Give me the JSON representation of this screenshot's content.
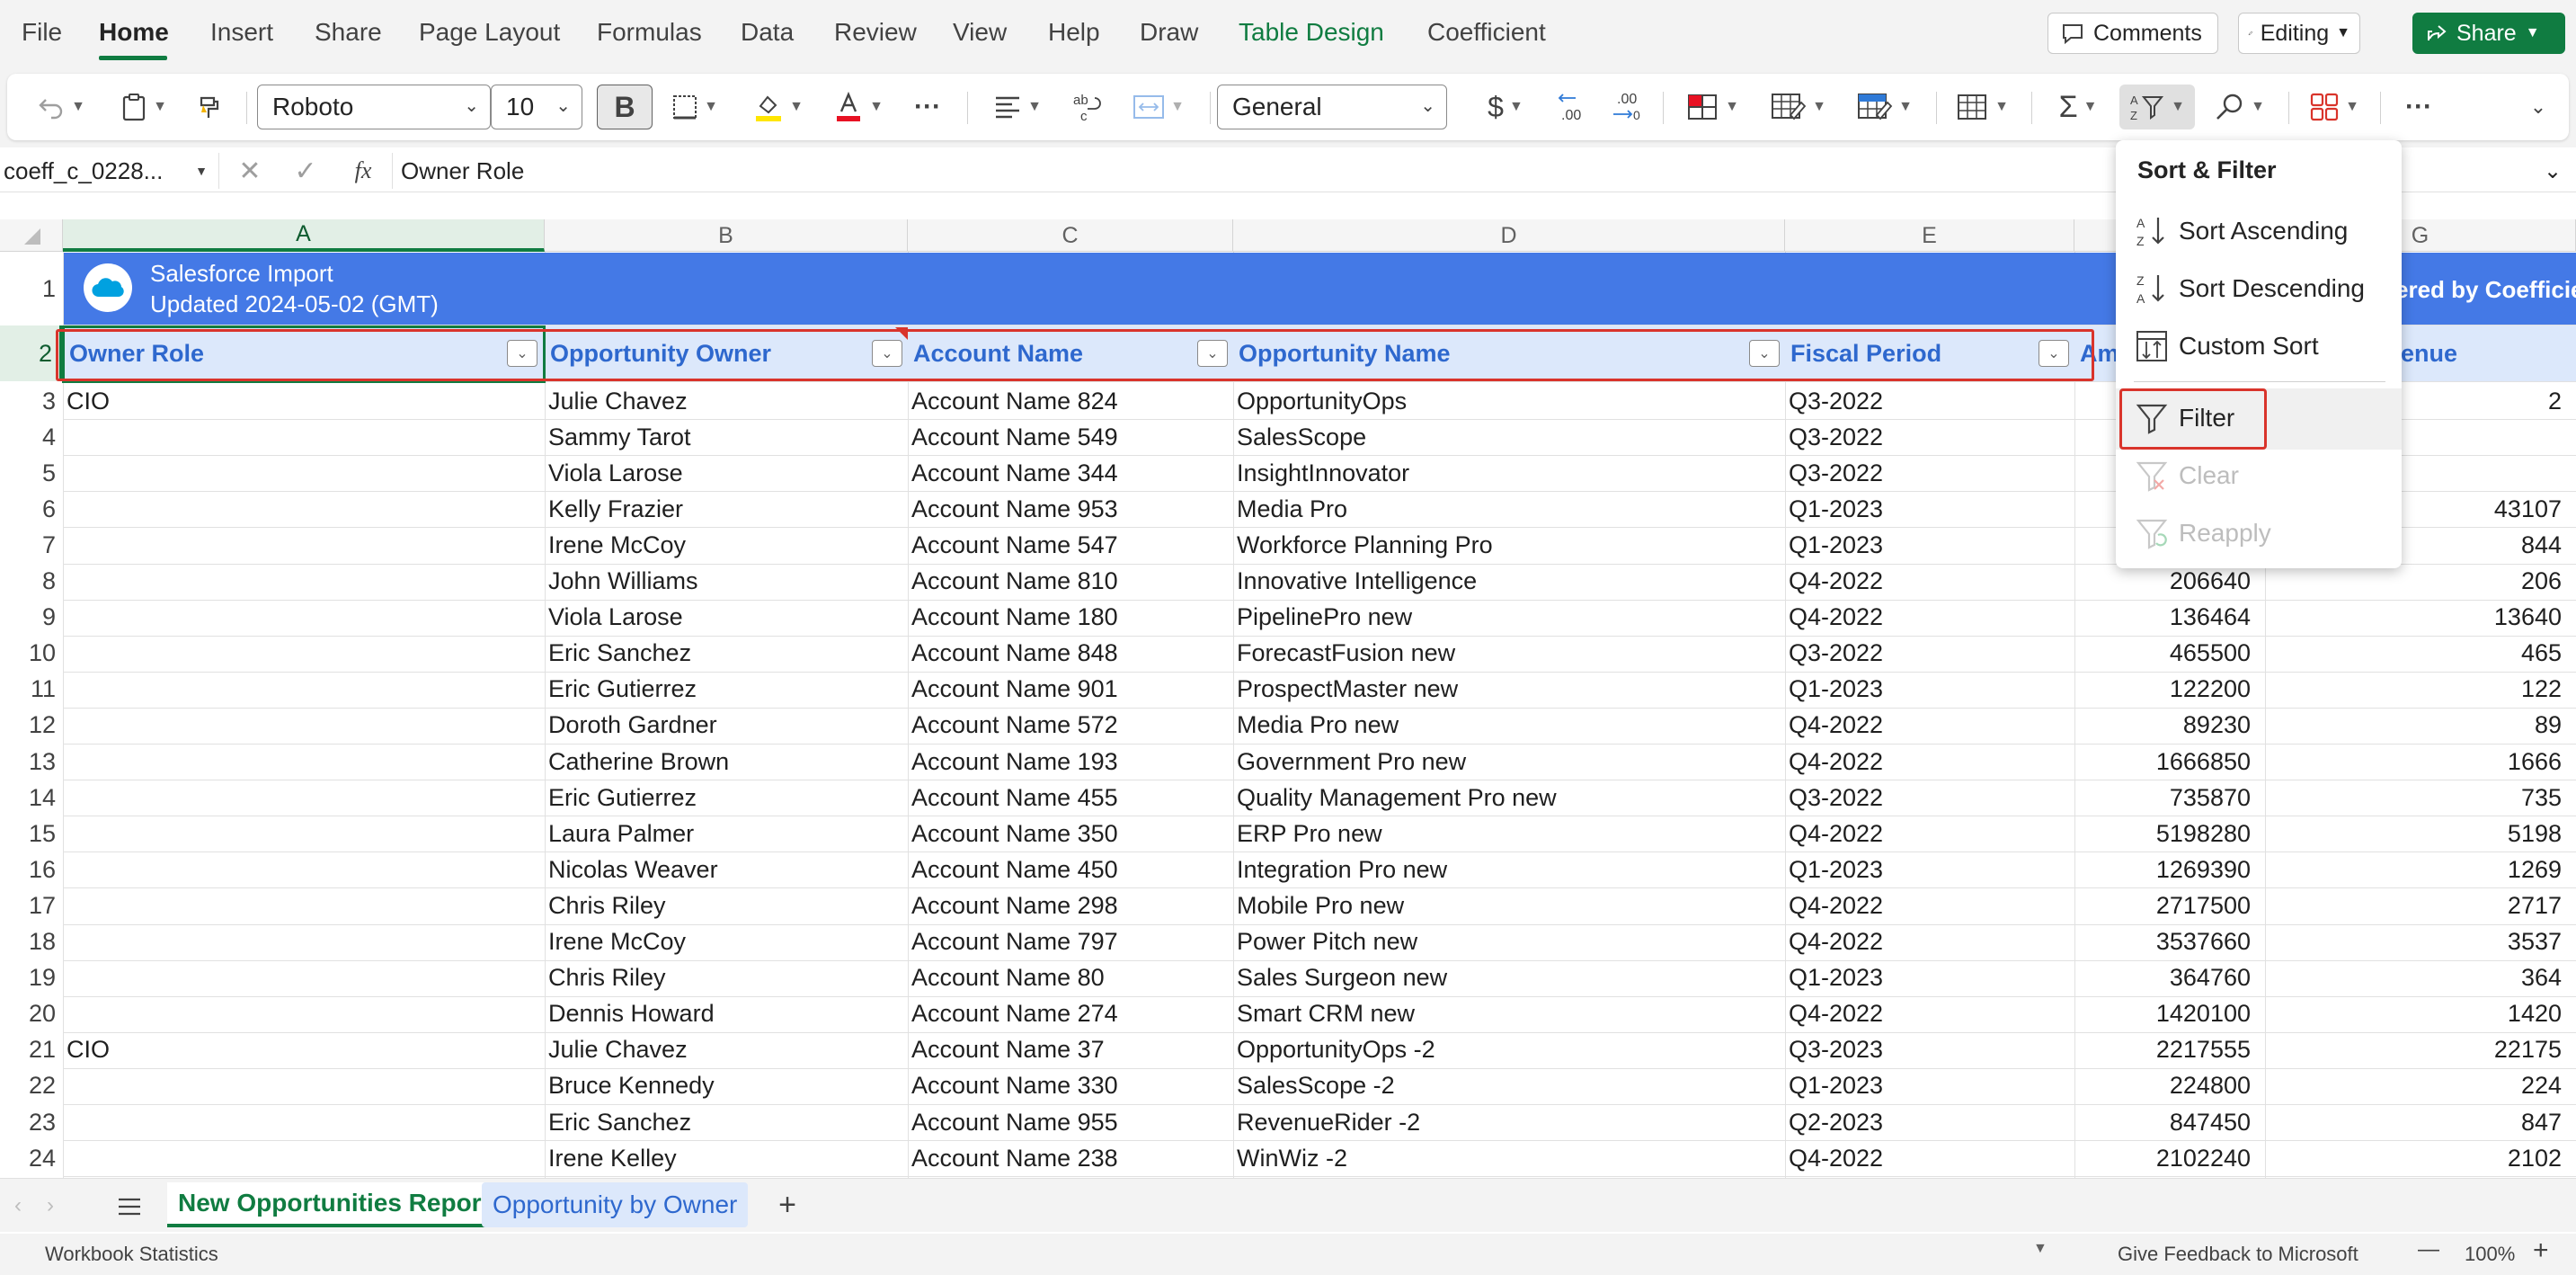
{
  "menu": {
    "tabs": [
      "File",
      "Home",
      "Insert",
      "Share",
      "Page Layout",
      "Formulas",
      "Data",
      "Review",
      "View",
      "Help",
      "Draw",
      "Table Design",
      "Coefficient"
    ],
    "comments_label": "Comments",
    "editing_label": "Editing",
    "share_label": "Share"
  },
  "ribbon": {
    "font_name": "Roboto",
    "font_size": "10",
    "bold_label": "B",
    "number_format": "General",
    "more_label": "···"
  },
  "formula_bar": {
    "name_box": "coeff_c_0228...",
    "fx_label": "fx",
    "content": "Owner Role"
  },
  "grid": {
    "columns": [
      "A",
      "B",
      "C",
      "D",
      "E",
      "F",
      "G"
    ],
    "banner_title": "Salesforce Import",
    "banner_subtitle": "Updated 2024-05-02 (GMT)",
    "banner_right": "ered by Coefficien",
    "headers": [
      "Owner Role",
      "Opportunity Owner",
      "Account Name",
      "Opportunity Name",
      "Fiscal Period",
      "Am",
      "venue"
    ],
    "row_numbers": [
      "1",
      "2",
      "3",
      "4",
      "5",
      "6",
      "7",
      "8",
      "9",
      "10",
      "11",
      "12",
      "13",
      "14",
      "15",
      "16",
      "17",
      "18",
      "19",
      "20",
      "21",
      "22",
      "23",
      "24"
    ],
    "rows": [
      {
        "role": "CIO",
        "owner": "Julie Chavez",
        "account": "Account Name 824",
        "opp": "OpportunityOps",
        "period": "Q3-2022",
        "amount": "",
        "revenue": "2"
      },
      {
        "role": "",
        "owner": "Sammy Tarot",
        "account": "Account Name 549",
        "opp": "SalesScope",
        "period": "Q3-2022",
        "amount": "",
        "revenue": ""
      },
      {
        "role": "",
        "owner": "Viola Larose",
        "account": "Account Name 344",
        "opp": "InsightInnovator",
        "period": "Q3-2022",
        "amount": "",
        "revenue": ""
      },
      {
        "role": "",
        "owner": "Kelly Frazier",
        "account": "Account Name 953",
        "opp": "Media Pro",
        "period": "Q1-2023",
        "amount": "",
        "revenue": "43107"
      },
      {
        "role": "",
        "owner": "Irene McCoy",
        "account": "Account Name 547",
        "opp": "Workforce Planning Pro",
        "period": "Q1-2023",
        "amount": "",
        "revenue": "844"
      },
      {
        "role": "",
        "owner": "John Williams",
        "account": "Account Name 810",
        "opp": "Innovative Intelligence",
        "period": "Q4-2022",
        "amount": "206640",
        "revenue": "206"
      },
      {
        "role": "",
        "owner": "Viola Larose",
        "account": "Account Name 180",
        "opp": "PipelinePro new",
        "period": "Q4-2022",
        "amount": "136464",
        "revenue": "13640"
      },
      {
        "role": "",
        "owner": "Eric Sanchez",
        "account": "Account Name 848",
        "opp": "ForecastFusion new",
        "period": "Q3-2022",
        "amount": "465500",
        "revenue": "465"
      },
      {
        "role": "",
        "owner": "Eric Gutierrez",
        "account": "Account Name 901",
        "opp": "ProspectMaster new",
        "period": "Q1-2023",
        "amount": "122200",
        "revenue": "122"
      },
      {
        "role": "",
        "owner": "Doroth Gardner",
        "account": "Account Name 572",
        "opp": "Media Pro new",
        "period": "Q4-2022",
        "amount": "89230",
        "revenue": "89"
      },
      {
        "role": "",
        "owner": "Catherine Brown",
        "account": "Account Name 193",
        "opp": "Government Pro new",
        "period": "Q4-2022",
        "amount": "1666850",
        "revenue": "1666"
      },
      {
        "role": "",
        "owner": "Eric Gutierrez",
        "account": "Account Name 455",
        "opp": "Quality Management Pro new",
        "period": "Q3-2022",
        "amount": "735870",
        "revenue": "735"
      },
      {
        "role": "",
        "owner": "Laura Palmer",
        "account": "Account Name 350",
        "opp": "ERP Pro new",
        "period": "Q4-2022",
        "amount": "5198280",
        "revenue": "5198"
      },
      {
        "role": "",
        "owner": "Nicolas Weaver",
        "account": "Account Name 450",
        "opp": "Integration Pro new",
        "period": "Q1-2023",
        "amount": "1269390",
        "revenue": "1269"
      },
      {
        "role": "",
        "owner": "Chris Riley",
        "account": "Account Name 298",
        "opp": "Mobile Pro new",
        "period": "Q4-2022",
        "amount": "2717500",
        "revenue": "2717"
      },
      {
        "role": "",
        "owner": "Irene McCoy",
        "account": "Account Name 797",
        "opp": "Power Pitch new",
        "period": "Q4-2022",
        "amount": "3537660",
        "revenue": "3537"
      },
      {
        "role": "",
        "owner": "Chris Riley",
        "account": "Account Name 80",
        "opp": "Sales Surgeon new",
        "period": "Q1-2023",
        "amount": "364760",
        "revenue": "364"
      },
      {
        "role": "",
        "owner": "Dennis Howard",
        "account": "Account Name 274",
        "opp": "Smart CRM new",
        "period": "Q4-2022",
        "amount": "1420100",
        "revenue": "1420"
      },
      {
        "role": "CIO",
        "owner": "Julie Chavez",
        "account": "Account Name 37",
        "opp": "OpportunityOps -2",
        "period": "Q3-2023",
        "amount": "2217555",
        "revenue": "22175"
      },
      {
        "role": "",
        "owner": "Bruce Kennedy",
        "account": "Account Name 330",
        "opp": "SalesScope -2",
        "period": "Q1-2023",
        "amount": "224800",
        "revenue": "224"
      },
      {
        "role": "",
        "owner": "Eric Sanchez",
        "account": "Account Name 955",
        "opp": "RevenueRider -2",
        "period": "Q2-2023",
        "amount": "847450",
        "revenue": "847"
      },
      {
        "role": "",
        "owner": "Irene Kelley",
        "account": "Account Name 238",
        "opp": "WinWiz -2",
        "period": "Q4-2022",
        "amount": "2102240",
        "revenue": "2102"
      }
    ]
  },
  "sort_filter_menu": {
    "title": "Sort & Filter",
    "items": [
      "Sort Ascending",
      "Sort Descending",
      "Custom Sort",
      "Filter",
      "Clear",
      "Reapply"
    ]
  },
  "sheets": {
    "tabs": [
      "New Opportunities Report",
      "Opportunity by Owner"
    ],
    "add_label": "+"
  },
  "status": {
    "left": "Workbook Statistics",
    "feedback": "Give Feedback to Microsoft",
    "zoom": "100%",
    "minus": "—",
    "plus": "+"
  },
  "colors": {
    "accent_green": "#107c41",
    "banner_blue": "#4479e6",
    "header_text_blue": "#2e68ce",
    "highlight_red": "#d9342b"
  }
}
